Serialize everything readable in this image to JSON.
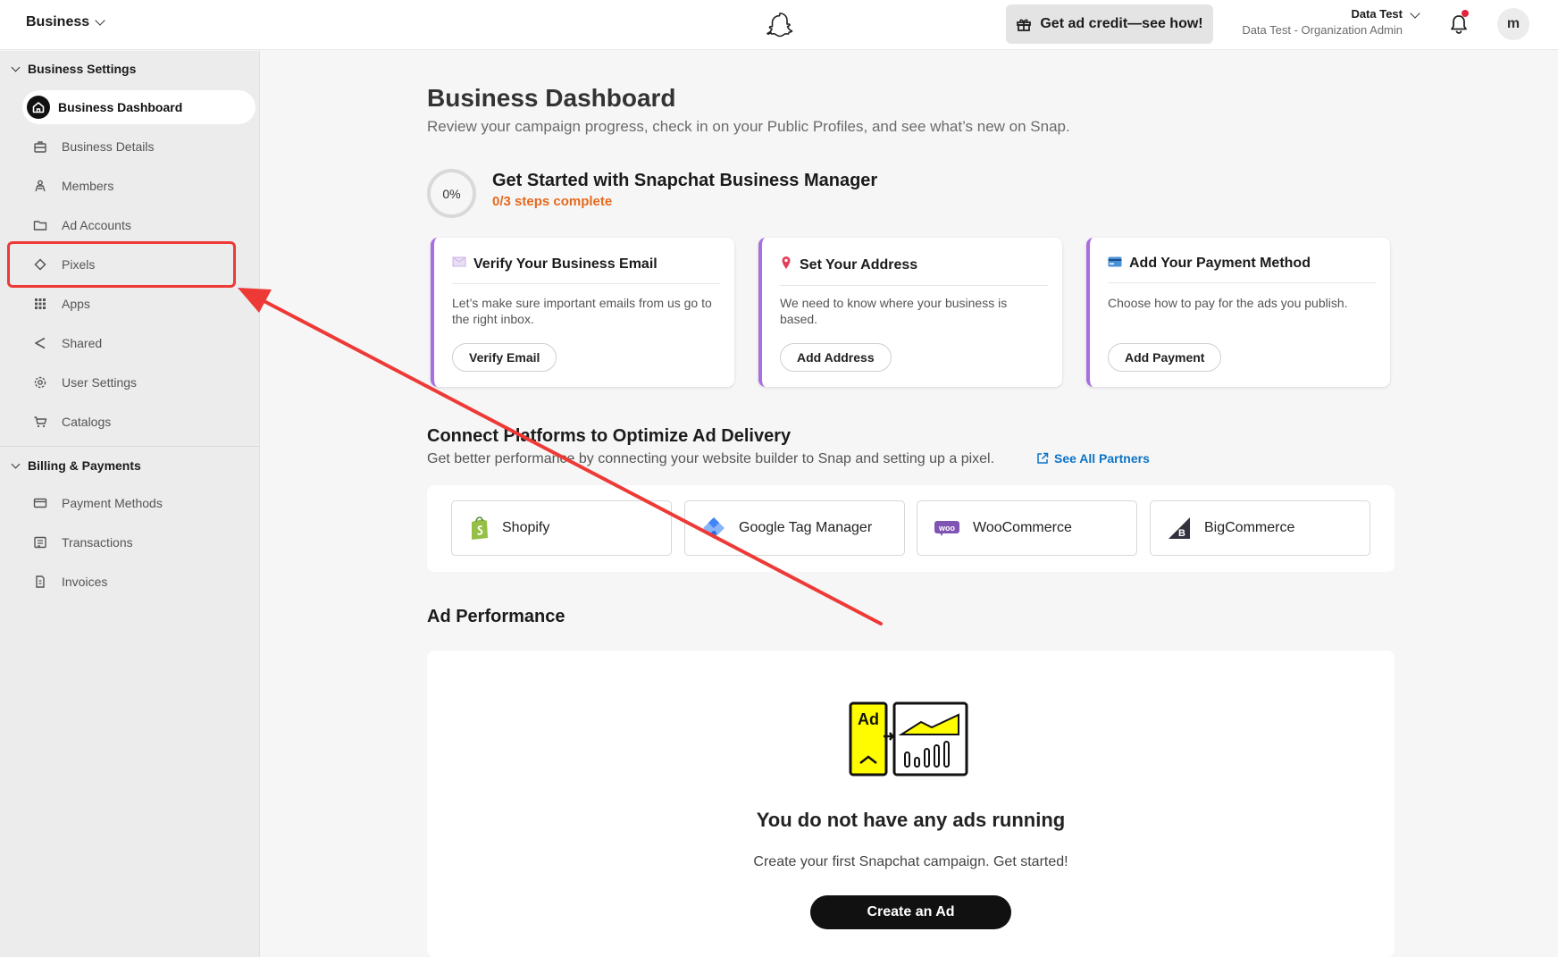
{
  "header": {
    "business_switcher": "Business",
    "credit_button": "Get ad credit—see how!",
    "user_name": "Data Test",
    "user_role": "Data Test - Organization Admin",
    "avatar_initial": "m"
  },
  "sidebar": {
    "sections": [
      {
        "title": "Business Settings",
        "items": [
          {
            "label": "Business Dashboard",
            "icon": "home-icon",
            "active": true
          },
          {
            "label": "Business Details",
            "icon": "briefcase-icon"
          },
          {
            "label": "Members",
            "icon": "members-icon"
          },
          {
            "label": "Ad Accounts",
            "icon": "folder-icon"
          },
          {
            "label": "Pixels",
            "icon": "diamond-icon",
            "highlighted": true
          },
          {
            "label": "Apps",
            "icon": "apps-grid-icon"
          },
          {
            "label": "Shared",
            "icon": "share-icon"
          },
          {
            "label": "User Settings",
            "icon": "gear-icon"
          },
          {
            "label": "Catalogs",
            "icon": "cart-icon"
          }
        ]
      },
      {
        "title": "Billing & Payments",
        "items": [
          {
            "label": "Payment Methods",
            "icon": "card-icon"
          },
          {
            "label": "Transactions",
            "icon": "transactions-icon"
          },
          {
            "label": "Invoices",
            "icon": "invoice-icon"
          }
        ]
      }
    ]
  },
  "main": {
    "title": "Business Dashboard",
    "subtitle": "Review your campaign progress, check in on your Public Profiles, and see what’s new on Snap.",
    "get_started": {
      "progress": "0%",
      "title": "Get Started with Snapchat Business Manager",
      "steps": "0/3 steps complete",
      "cards": [
        {
          "title": "Verify Your Business Email",
          "body": "Let’s make sure important emails from us go to the right inbox.",
          "button": "Verify Email",
          "icon": "envelope-icon"
        },
        {
          "title": "Set Your Address",
          "body": "We need to know where your business is based.",
          "button": "Add Address",
          "icon": "pin-icon"
        },
        {
          "title": "Add Your Payment Method",
          "body": "Choose how to pay for the ads you publish.",
          "button": "Add Payment",
          "icon": "credit-card-icon"
        }
      ]
    },
    "connect": {
      "title": "Connect Platforms to Optimize Ad Delivery",
      "subtitle": "Get better performance by connecting your website builder to Snap and setting up a pixel.",
      "link": "See All Partners",
      "platforms": [
        {
          "name": "Shopify",
          "icon": "shopify-icon"
        },
        {
          "name": "Google Tag Manager",
          "icon": "gtm-icon"
        },
        {
          "name": "WooCommerce",
          "icon": "woocommerce-icon"
        },
        {
          "name": "BigCommerce",
          "icon": "bigcommerce-icon"
        }
      ]
    },
    "ad_performance": {
      "title": "Ad Performance",
      "illustration_text": "Ad",
      "empty_title": "You do not have any ads running",
      "empty_desc": "Create your first Snapchat campaign. Get started!",
      "button": "Create an Ad"
    }
  },
  "colors": {
    "accent_orange": "#e46a1e",
    "card_border_purple": "#a96ee0",
    "annotation_red": "#ee3a36",
    "link_blue": "#0b74c7",
    "snap_yellow": "#fffc00"
  }
}
